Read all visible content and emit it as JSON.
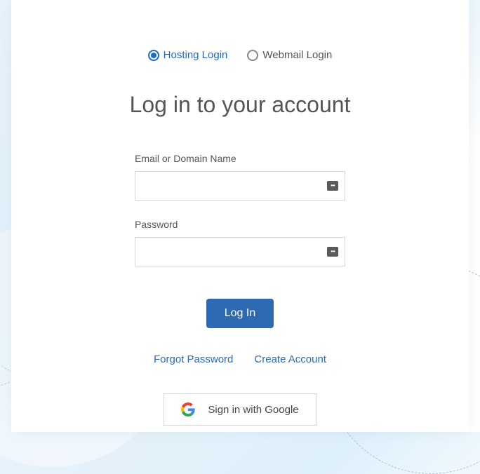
{
  "tabs": {
    "hosting": "Hosting Login",
    "webmail": "Webmail Login"
  },
  "title": "Log in to your account",
  "form": {
    "email_label": "Email or Domain Name",
    "password_label": "Password",
    "submit": "Log In"
  },
  "links": {
    "forgot": "Forgot Password",
    "create": "Create Account"
  },
  "google": {
    "label": "Sign in with Google"
  },
  "colors": {
    "primary": "#2e6ab1",
    "accent": "#1b69c9"
  }
}
